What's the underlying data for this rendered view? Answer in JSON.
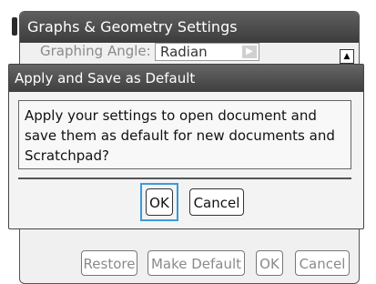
{
  "background_window": {
    "title": "Graphs & Geometry Settings",
    "row_label": "Graphing Angle:",
    "row_value": "Radian",
    "footer_buttons": [
      "Restore",
      "Make Default",
      "OK",
      "Cancel"
    ]
  },
  "dialog": {
    "title": "Apply and Save as Default",
    "message": "Apply your settings to open document and save them as default for new documents and Scratchpad?",
    "ok_label": "OK",
    "cancel_label": "Cancel"
  },
  "icons": {
    "scroll_up": "up-arrow-icon",
    "dropdown": "dropdown-arrow-icon"
  },
  "colors": {
    "titlebar": "#4a4a4a",
    "focus": "#3a9bd9"
  }
}
